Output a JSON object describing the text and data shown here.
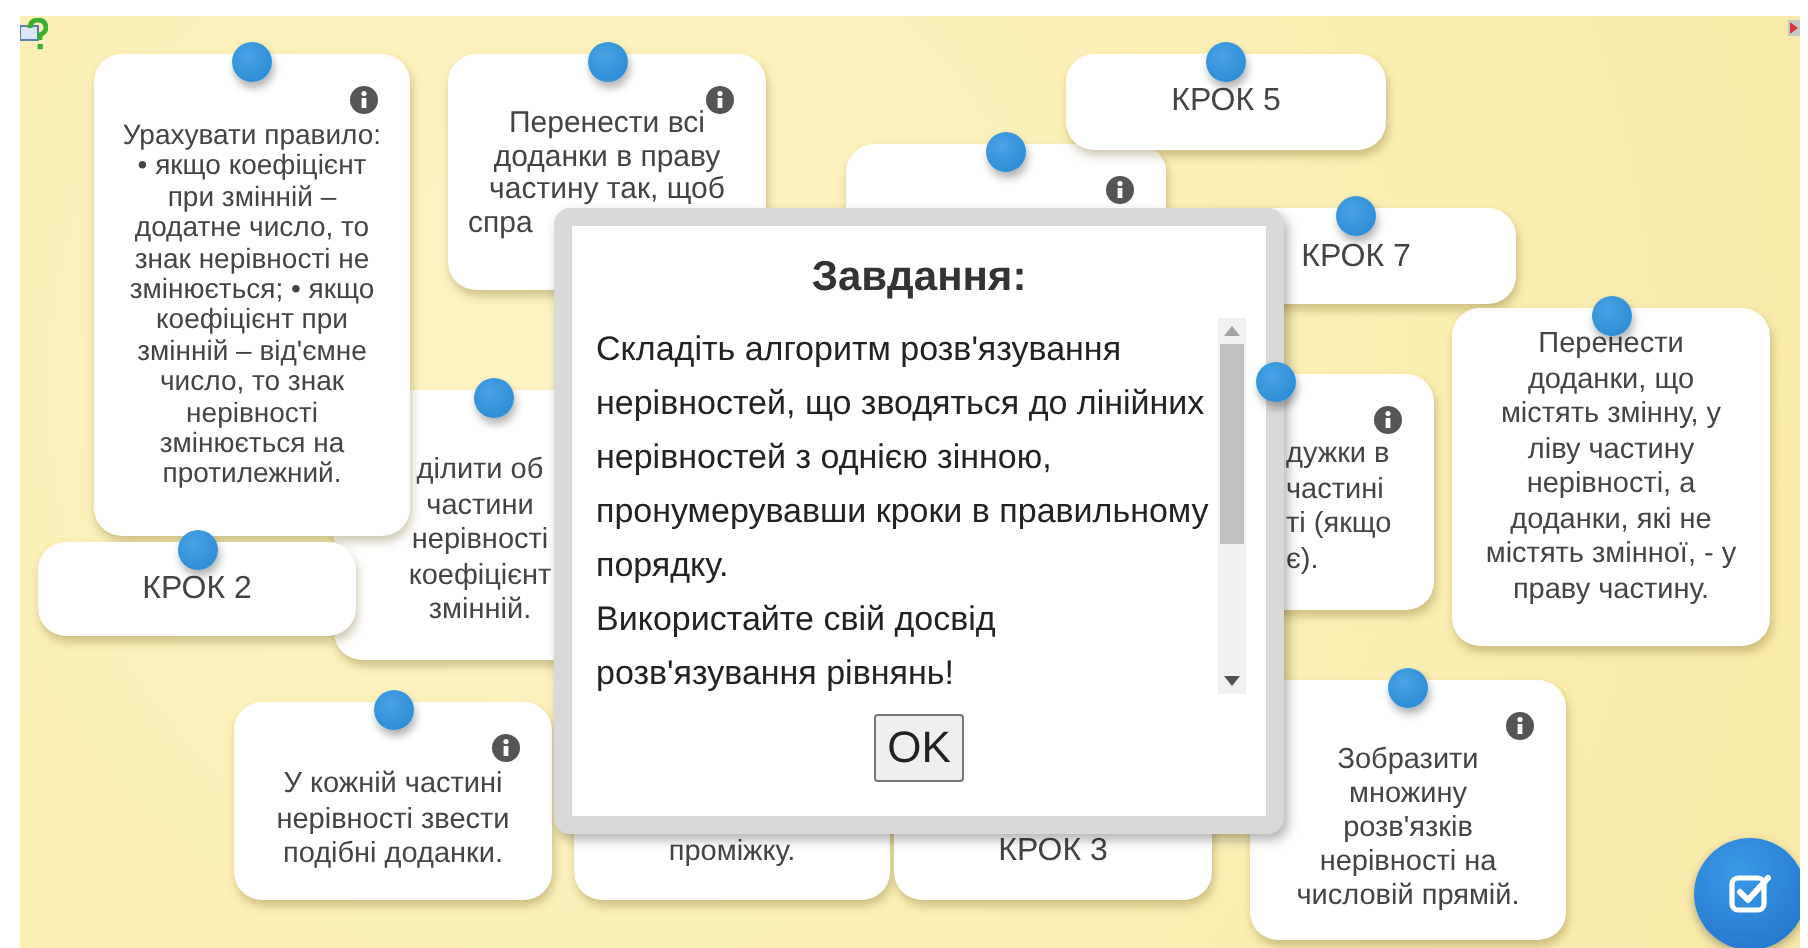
{
  "cards": [
    {
      "kind": "note",
      "info": true,
      "pin": true
    },
    {
      "kind": "step",
      "info": false,
      "pin": true,
      "text": "КРОК 5"
    },
    {
      "kind": "step",
      "info": false,
      "pin": true,
      "text": "КРОК 7"
    },
    {
      "kind": "note",
      "info": false,
      "pin": true,
      "lines": [
        "ділити об",
        "частини",
        "нерівності",
        "коефіцієнт",
        "змінній."
      ]
    },
    {
      "kind": "note",
      "info": true,
      "pin": true,
      "text": "Урахувати правило: • якщо коефіцієнт при змінній – додатне число, то знак нерівності не змінюється; • якщо коефіцієнт при змінній – від'ємне число, то знак нерівності змінюється на протилежний."
    },
    {
      "kind": "step",
      "info": false,
      "pin": true,
      "text": "КРОК 2"
    },
    {
      "kind": "note",
      "info": true,
      "pin": true,
      "lines": [
        "Перенести всі",
        "доданки в праву",
        "частину так, щоб",
        "спра"
      ]
    },
    {
      "kind": "note",
      "info": true,
      "pin": true,
      "lines": [
        "дужки в",
        "частині",
        "ті (якщо",
        "є)."
      ]
    },
    {
      "kind": "note",
      "info": false,
      "pin": true,
      "text": "Перенести доданки, що містять змінну, у ліву частину нерівності, а доданки, які не містять змінної, - у праву частину."
    },
    {
      "kind": "note",
      "info": true,
      "pin": true,
      "text": "У кожній частині нерівності звести подібні доданки."
    },
    {
      "kind": "note",
      "info": false,
      "pin": false,
      "text": "проміжку."
    },
    {
      "kind": "step",
      "info": false,
      "pin": false,
      "text": "КРОК 3"
    },
    {
      "kind": "note",
      "info": true,
      "pin": true,
      "text": "Зобразити множину розв'язків нерівності на числовій прямій."
    }
  ],
  "dialog": {
    "title": "Завдання:",
    "paragraphs": [
      "Складіть алгоритм розв'язування нерівностей, що зводяться до лінійних нерівностей з однією зінною, пронумерувавши кроки в правильному порядку.",
      "Використайте свій досвід розв'язування рівнянь!"
    ],
    "button": "OK"
  }
}
